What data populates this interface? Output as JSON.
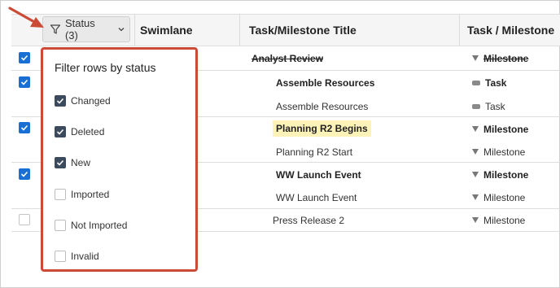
{
  "header": {
    "status_button_label": "Status (3)",
    "columns": [
      "Swimlane",
      "Task/Milestone Title",
      "Task / Milestone"
    ]
  },
  "filter_popup": {
    "title": "Filter rows by status",
    "options": [
      {
        "label": "Changed",
        "checked": true
      },
      {
        "label": "Deleted",
        "checked": true
      },
      {
        "label": "New",
        "checked": true
      },
      {
        "label": "Imported",
        "checked": false
      },
      {
        "label": "Not Imported",
        "checked": false
      },
      {
        "label": "Invalid",
        "checked": false
      }
    ]
  },
  "rows": [
    {
      "title": "Analyst Review",
      "type": "Milestone",
      "type_icon": "milestone-triangle-icon",
      "bold": true,
      "struck": true,
      "selected": true
    },
    {
      "title": "Assemble Resources",
      "type": "Task",
      "type_icon": "task-bar-icon",
      "bold": true,
      "selected": true
    },
    {
      "title": "Assemble Resources",
      "type": "Task",
      "type_icon": "task-bar-icon",
      "bold": false
    },
    {
      "title": "Planning R2 Begins",
      "type": "Milestone",
      "type_icon": "milestone-triangle-icon",
      "bold": true,
      "highlight": true,
      "selected": true
    },
    {
      "title": "Planning R2 Start",
      "type": "Milestone",
      "type_icon": "milestone-triangle-icon",
      "bold": false
    },
    {
      "title": "WW Launch Event",
      "type": "Milestone",
      "type_icon": "milestone-triangle-icon",
      "bold": true,
      "selected": true
    },
    {
      "title": "WW Launch Event",
      "type": "Milestone",
      "type_icon": "milestone-triangle-icon",
      "bold": false
    },
    {
      "title": "Press Release 2",
      "type": "Milestone",
      "type_icon": "milestone-triangle-icon",
      "bold": false,
      "selected": false
    }
  ],
  "colors": {
    "checkbox_blue": "#1a6fd4",
    "popup_border": "#cc4b36",
    "highlight": "#fdf2b8",
    "popup_checkbox": "#3b4a5c"
  }
}
